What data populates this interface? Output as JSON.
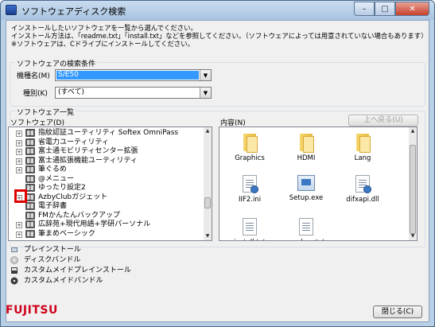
{
  "window": {
    "title": "ソフトウェアディスク検索",
    "controls": {
      "minimize": "–",
      "maximize": "□",
      "close": "✕"
    }
  },
  "instructions": [
    "インストールしたいソフトウェアを一覧から選んでください。",
    "インストール方法は、「readme.txt」「install.txt」などを参照してください。（ソフトウェアによっては用意されていない場合もあります）",
    "※ソフトウェアは、Cドライブにインストールしてください。"
  ],
  "search": {
    "group_label": "ソフトウェアの検索条件",
    "model_label": "機種名(M)",
    "model_value": "S/E50",
    "type_label": "種別(K)",
    "type_value": "(すべて)"
  },
  "list": {
    "group_label": "ソフトウェア一覧",
    "tree_label": "ソフトウェア(D)",
    "content_label": "内容(N)",
    "up_button": "上へ戻る(U)",
    "tree_items": [
      {
        "label": "指紋認証ユーティリティ Softex OmniPass",
        "expander": "+"
      },
      {
        "label": "省電力ユーティリティ",
        "expander": "+"
      },
      {
        "label": "富士通モビリティセンター拡張",
        "expander": "+"
      },
      {
        "label": "富士通拡張機能ユーティリティ",
        "expander": "+"
      },
      {
        "label": "筆ぐるめ",
        "expander": "+"
      },
      {
        "label": "@メニュー",
        "expander": ""
      },
      {
        "label": "ゆったり設定2",
        "expander": ""
      },
      {
        "label": "AzbyClubガジェット",
        "expander": "+"
      },
      {
        "label": "電子辞書",
        "expander": ""
      },
      {
        "label": "FMかんたんバックアップ",
        "expander": ""
      },
      {
        "label": "広辞苑+現代用語+学研パーソナル",
        "expander": "+"
      },
      {
        "label": "筆まめベーシック",
        "expander": "+"
      }
    ],
    "files": [
      {
        "label": "Graphics",
        "icon": "folder-icon"
      },
      {
        "label": "HDMI",
        "icon": "folder-icon"
      },
      {
        "label": "Lang",
        "icon": "folder-icon"
      },
      {
        "label": "IIF2.ini",
        "icon": "ini-file-icon"
      },
      {
        "label": "Setup.exe",
        "icon": "setup-exe-icon"
      },
      {
        "label": "difxapi.dll",
        "icon": "dll-file-icon"
      },
      {
        "label": "install.txt",
        "icon": "text-file-icon"
      },
      {
        "label": "readme.txt",
        "icon": "text-file-icon"
      }
    ]
  },
  "legend": [
    {
      "label": "プレインストール",
      "icon": "preinstall-icon"
    },
    {
      "label": "ディスクバンドル",
      "icon": "disc-bundle-icon"
    },
    {
      "label": "カスタムメイドプレインストール",
      "icon": "custom-preinstall-icon"
    },
    {
      "label": "カスタムメイドバンドル",
      "icon": "custom-bundle-icon"
    }
  ],
  "footer": {
    "close_button": "閉じる(C)",
    "brand": "FUJITSU"
  }
}
